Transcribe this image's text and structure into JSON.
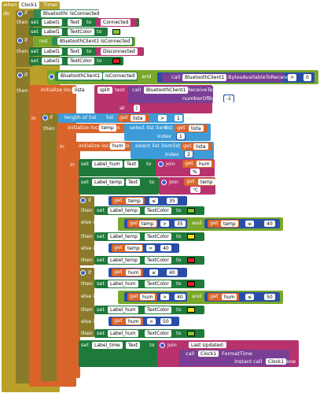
{
  "event": {
    "when": "when",
    "component": "Clock1",
    "event": "Timer",
    "do": "do"
  },
  "kw": {
    "if": "if",
    "then": "then",
    "else_if": "else if",
    "not": "not",
    "set": "set",
    "to": "to",
    "get": "get",
    "call": "call",
    "and": "and",
    "at": "at",
    "in": "in",
    "join": "join",
    "text": "text",
    "index": "index",
    "instant": "instant"
  },
  "block1": {
    "cond_comp": "BluetoothClient1",
    "cond_prop": "IsConnected",
    "set1_comp": "Label1",
    "set1_prop": "Text",
    "set1_val": "Connected",
    "set2_comp": "Label1",
    "set2_prop": "TextColor",
    "color": "#7cc832"
  },
  "block2": {
    "cond_comp": "BluetoothClient1",
    "cond_prop": "IsConnected",
    "set1_comp": "Label1",
    "set1_prop": "Text",
    "set1_val": "Disconnected",
    "set2_comp": "Label1",
    "set2_prop": "TextColor",
    "color": "#e02020"
  },
  "block3": {
    "cond_comp": "BluetoothClient1",
    "cond_prop": "IsConnected",
    "bytes_comp": "BluetoothClient1",
    "bytes_method": "BytesAvailableToReceive",
    "op": ">",
    "num": "0"
  },
  "local_lista": {
    "label": "initialize local",
    "name": "lista",
    "to": "to",
    "split": "split",
    "recv_comp": "BluetoothClient1",
    "recv_method": "ReceiveText",
    "num_bytes": "numberOfBytes",
    "num_val": "-1",
    "at_val": "|"
  },
  "if_len": {
    "label": "length of list",
    "list": "list",
    "get_var": "lista",
    "op": ">",
    "num": "1"
  },
  "local_temp": {
    "label": "initialize local",
    "name": "temp",
    "to": "to",
    "select": "select list item",
    "list": "list",
    "get_var": "lista",
    "index": "1"
  },
  "local_hum": {
    "label": "initialize local",
    "name": "hum",
    "to": "to",
    "select": "select list item",
    "list": "list",
    "get_var": "lista",
    "index": "2"
  },
  "set_hum": {
    "comp": "Label_hum",
    "prop": "Text",
    "get_var": "hum",
    "suffix": "%"
  },
  "set_temp": {
    "comp": "Label_temp",
    "prop": "Text",
    "get_var": "temp",
    "suffix": "°C"
  },
  "temp_rules": [
    {
      "kw": "if",
      "var": "temp",
      "op": "≤",
      "num": "35",
      "comp": "Label_temp",
      "prop": "TextColor",
      "color": "#7cc832"
    },
    {
      "kw": "else if",
      "var": "temp",
      "op": ">",
      "num": "35",
      "and": "and",
      "var2": "temp",
      "op2": "≤",
      "num2": "40",
      "comp": "Label_temp",
      "prop": "TextColor",
      "color": "#f0e020"
    },
    {
      "kw": "else if",
      "var": "temp",
      "op": ">",
      "num": "40",
      "comp": "Label_temp",
      "prop": "TextColor",
      "color": "#e02020"
    }
  ],
  "hum_rules": [
    {
      "kw": "if",
      "var": "hum",
      "op": "≤",
      "num": "40",
      "comp": "Label_hum",
      "prop": "TextColor",
      "color": "#e02020"
    },
    {
      "kw": "else if",
      "var": "hum",
      "op": ">",
      "num": "40",
      "and": "and",
      "var2": "hum",
      "op2": "≤",
      "num2": "50",
      "comp": "Label_hum",
      "prop": "TextColor",
      "color": "#f0e020"
    },
    {
      "kw": "else if",
      "var": "hum",
      "op": ">",
      "num": "50",
      "comp": "Label_hum",
      "prop": "TextColor",
      "color": "#7cc832"
    }
  ],
  "set_time": {
    "comp": "Label_time",
    "prop": "Text",
    "prefix": "Last Updated: ",
    "fmt_comp": "Clock1",
    "fmt_method": "FormatTime",
    "now_comp": "Clock1",
    "now_method": "Now"
  }
}
